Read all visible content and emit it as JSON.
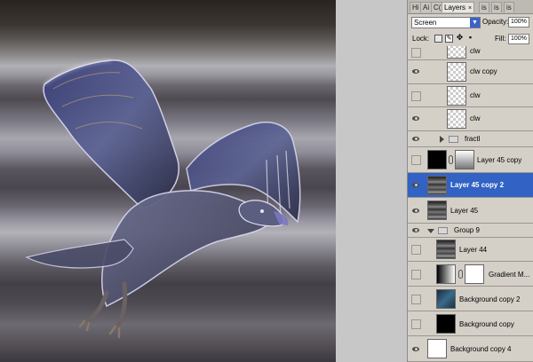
{
  "panel": {
    "tabs": [
      {
        "label": "Hi"
      },
      {
        "label": "Ai"
      },
      {
        "label": "C("
      },
      {
        "label": "Layers",
        "close": "×"
      },
      {
        "label": "is"
      },
      {
        "label": "is"
      },
      {
        "label": "is"
      }
    ],
    "blend_mode": "Screen",
    "opacity_label": "Opacity:",
    "opacity_value": "100%",
    "lock_label": "Lock:",
    "fill_label": "Fill:",
    "fill_value": "100%"
  },
  "layers": [
    {
      "name": "clw",
      "visible": false,
      "thumb": "checker"
    },
    {
      "name": "clw copy",
      "visible": true,
      "thumb": "checker"
    },
    {
      "name": "clw",
      "visible": false,
      "thumb": "checker"
    },
    {
      "name": "clw",
      "visible": true,
      "thumb": "checker"
    },
    {
      "name": "fractl",
      "visible": true,
      "type": "group",
      "expanded": false
    },
    {
      "name": "Layer 45 copy",
      "visible": false,
      "thumb": "black",
      "mask": true
    },
    {
      "name": "Layer 45 copy 2",
      "visible": true,
      "thumb": "strip",
      "selected": true
    },
    {
      "name": "Layer 45",
      "visible": true,
      "thumb": "strip"
    },
    {
      "name": "Group 9",
      "visible": true,
      "type": "group",
      "expanded": true
    },
    {
      "name": "Layer 44",
      "visible": false,
      "thumb": "strip"
    },
    {
      "name": "Gradient M...",
      "visible": false,
      "thumb": "gradient",
      "mask": true
    },
    {
      "name": "Background copy 2",
      "visible": false,
      "thumb": "dark-blue"
    },
    {
      "name": "Background copy",
      "visible": false,
      "thumb": "black"
    },
    {
      "name": "Background copy 4",
      "visible": true,
      "thumb": "white"
    }
  ],
  "colors": {
    "selection": "#3162c4",
    "panel": "#d4d0c8"
  }
}
